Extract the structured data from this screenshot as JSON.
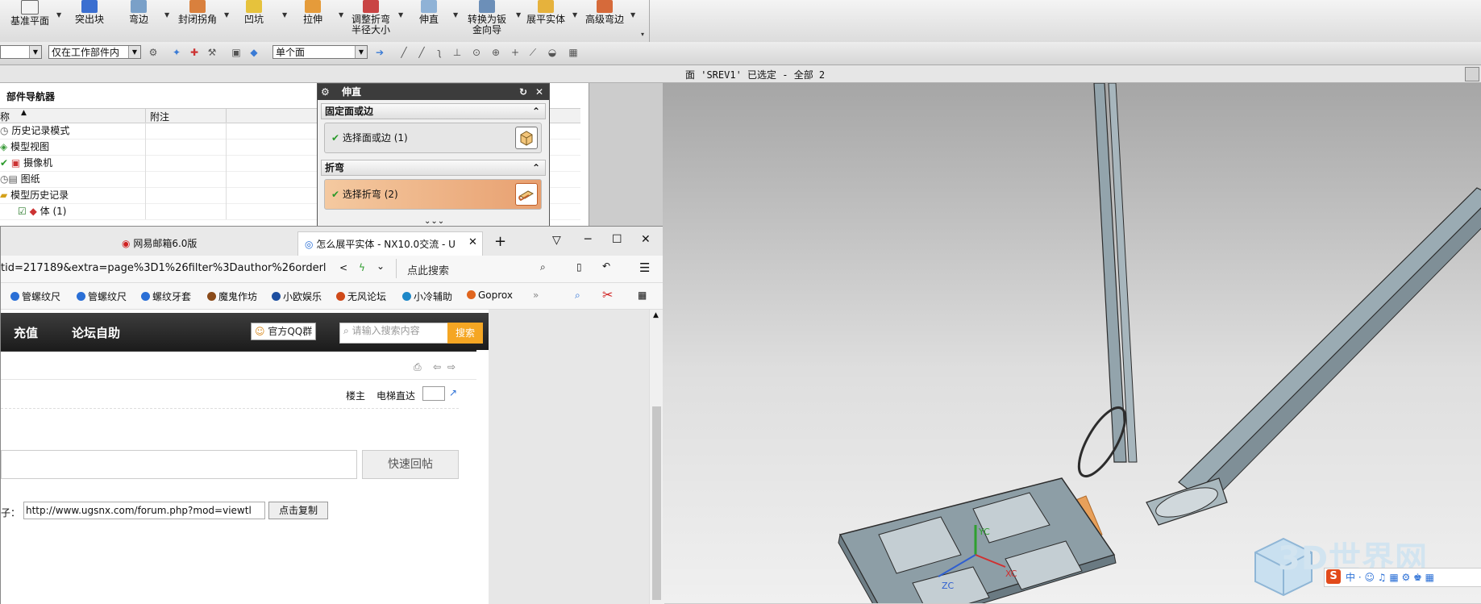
{
  "ribbon": {
    "items": [
      {
        "label": "基准平面",
        "label2": ""
      },
      {
        "label": "突出块",
        "label2": ""
      },
      {
        "label": "弯边",
        "label2": ""
      },
      {
        "label": "封闭拐角",
        "label2": ""
      },
      {
        "label": "凹坑",
        "label2": ""
      },
      {
        "label": "拉伸",
        "label2": ""
      },
      {
        "label": "调整折弯",
        "label2": "半径大小"
      },
      {
        "label": "伸直",
        "label2": ""
      },
      {
        "label": "转换为钣",
        "label2": "金向导"
      },
      {
        "label": "展平实体",
        "label2": ""
      },
      {
        "label": "高级弯边",
        "label2": ""
      }
    ]
  },
  "toolbar2": {
    "filter_value": "仅在工作部件内",
    "face_rule_value": "单个面"
  },
  "status": {
    "text": "面 'SREV1' 已选定 - 全部 2"
  },
  "navigator": {
    "title": "部件导航器",
    "col_name": "称",
    "col_note": "附注",
    "rows": [
      {
        "label": "历史记录模式"
      },
      {
        "label": "模型视图"
      },
      {
        "label": "摄像机"
      },
      {
        "label": "图纸"
      },
      {
        "label": "模型历史记录"
      },
      {
        "label": "体 (1)"
      }
    ]
  },
  "dialog": {
    "title": "伸直",
    "section1": "固定面或边",
    "select1": "选择面或边 (1)",
    "section2": "折弯",
    "select2": "选择折弯 (2)"
  },
  "browser": {
    "tabs": [
      {
        "label": "网易邮箱6.0版"
      },
      {
        "label": "怎么展平实体 - NX10.0交流 - U"
      }
    ],
    "url": "tid=217189&extra=page%3D1%26filter%3Dauthor%26orderl",
    "search_placeholder": "点此搜索",
    "bookmarks": [
      {
        "label": "管螺纹尺",
        "color": "#2a6fd6"
      },
      {
        "label": "管螺纹尺",
        "color": "#2a6fd6"
      },
      {
        "label": "螺纹牙套",
        "color": "#2a6fd6"
      },
      {
        "label": "魔鬼作坊",
        "color": "#8a4b1a"
      },
      {
        "label": "小欧娱乐",
        "color": "#1d4fa0"
      },
      {
        "label": "无风论坛",
        "color": "#d04a1a"
      },
      {
        "label": "小冷辅助",
        "color": "#1e88c8"
      },
      {
        "label": "Goprox",
        "color": "#e0651e"
      }
    ],
    "forum": {
      "nav1": "充值",
      "nav2": "论坛自助",
      "qq_label": "官方QQ群",
      "search_placeholder": "请输入搜索内容",
      "search_button": "搜索",
      "louzhu": "楼主",
      "dianti": "电梯直达",
      "quick_reply": "快速回帖",
      "copy_prefix": "子：",
      "copy_url": "http://www.ugsnx.com/forum.php?mod=viewtl",
      "copy_button": "点击复制"
    }
  },
  "viewport": {
    "axes": {
      "xc": "XC",
      "yc": "YC",
      "zc": "ZC"
    },
    "watermark": "3D世界网"
  },
  "colors": {
    "accent_orange": "#e8a05a",
    "dialog_title_bg": "#3c3c3c",
    "search_button": "#f5a623",
    "part_steel": "#8a9aa2"
  }
}
